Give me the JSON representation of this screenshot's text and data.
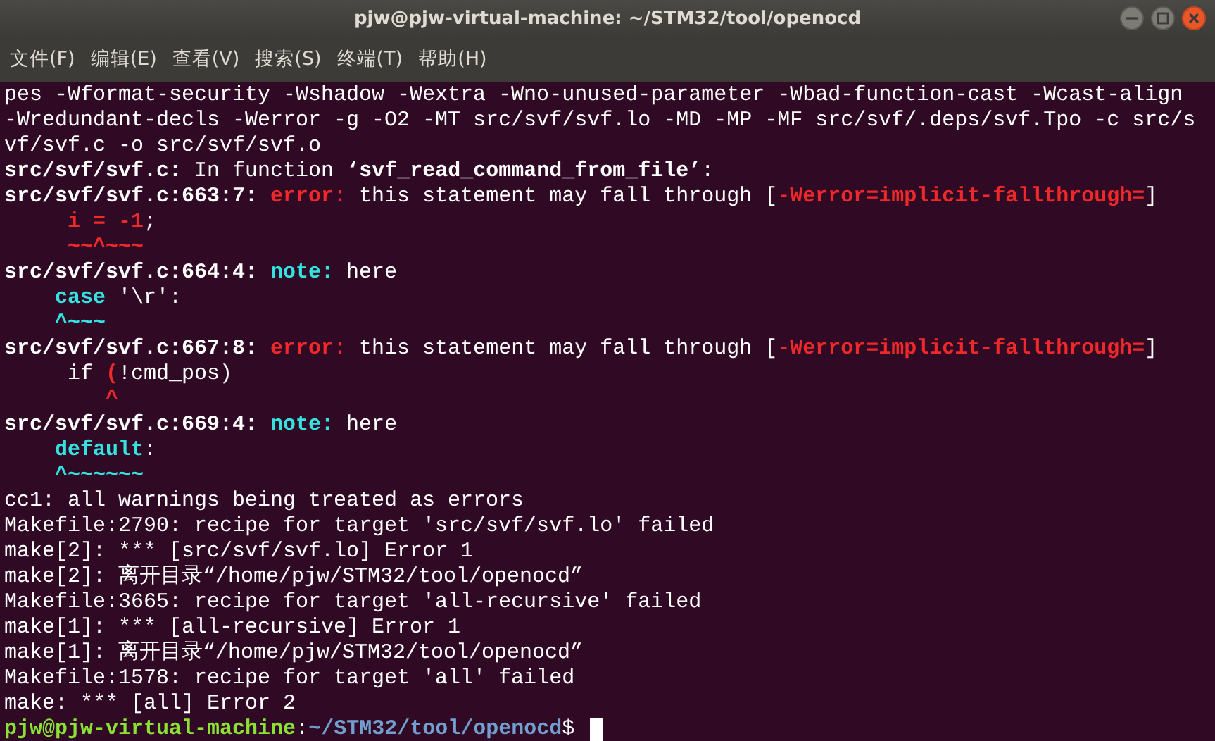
{
  "window": {
    "title": "pjw@pjw-virtual-machine: ~/STM32/tool/openocd"
  },
  "menu": [
    "文件(F)",
    "编辑(E)",
    "查看(V)",
    "搜索(S)",
    "终端(T)",
    "帮助(H)"
  ],
  "terminal": {
    "lines": [
      {
        "segments": [
          {
            "text": "pes -Wformat-security -Wshadow -Wextra -Wno-unused-parameter -Wbad-function-cast -Wcast-align",
            "kind": "plain"
          }
        ]
      },
      {
        "segments": [
          {
            "text": "-Wredundant-decls -Werror -g -O2 -MT src/svf/svf.lo -MD -MP -MF src/svf/.deps/svf.Tpo -c src/s",
            "kind": "plain"
          }
        ]
      },
      {
        "segments": [
          {
            "text": "vf/svf.c -o src/svf/svf.o",
            "kind": "plain"
          }
        ]
      },
      {
        "segments": [
          {
            "text": "src/svf/svf.c:",
            "kind": "bold"
          },
          {
            "text": " In function ",
            "kind": "plain"
          },
          {
            "text": "‘svf_read_command_from_file’",
            "kind": "bold"
          },
          {
            "text": ":",
            "kind": "plain"
          }
        ]
      },
      {
        "segments": [
          {
            "text": "src/svf/svf.c:663:7:",
            "kind": "bold"
          },
          {
            "text": " error:",
            "kind": "error"
          },
          {
            "text": " this statement may fall through [",
            "kind": "plain"
          },
          {
            "text": "-Werror=implicit-fallthrough=",
            "kind": "error"
          },
          {
            "text": "]",
            "kind": "plain"
          }
        ]
      },
      {
        "segments": [
          {
            "text": "     i = -1",
            "kind": "error"
          },
          {
            "text": ";",
            "kind": "plain"
          }
        ]
      },
      {
        "segments": [
          {
            "text": "     ~~^~~~",
            "kind": "error"
          }
        ]
      },
      {
        "segments": [
          {
            "text": "src/svf/svf.c:664:4:",
            "kind": "bold"
          },
          {
            "text": " note:",
            "kind": "note"
          },
          {
            "text": " here",
            "kind": "plain"
          }
        ]
      },
      {
        "segments": [
          {
            "text": "    case",
            "kind": "note"
          },
          {
            "text": " '\\r':",
            "kind": "plain"
          }
        ]
      },
      {
        "segments": [
          {
            "text": "    ^~~~",
            "kind": "note"
          }
        ]
      },
      {
        "segments": [
          {
            "text": "src/svf/svf.c:667:8:",
            "kind": "bold"
          },
          {
            "text": " error:",
            "kind": "error"
          },
          {
            "text": " this statement may fall through [",
            "kind": "plain"
          },
          {
            "text": "-Werror=implicit-fallthrough=",
            "kind": "error"
          },
          {
            "text": "]",
            "kind": "plain"
          }
        ]
      },
      {
        "segments": [
          {
            "text": "     if ",
            "kind": "plain"
          },
          {
            "text": "(",
            "kind": "error"
          },
          {
            "text": "!cmd_pos)",
            "kind": "plain"
          }
        ]
      },
      {
        "segments": [
          {
            "text": "        ^",
            "kind": "error"
          }
        ]
      },
      {
        "segments": [
          {
            "text": "src/svf/svf.c:669:4:",
            "kind": "bold"
          },
          {
            "text": " note:",
            "kind": "note"
          },
          {
            "text": " here",
            "kind": "plain"
          }
        ]
      },
      {
        "segments": [
          {
            "text": "    default",
            "kind": "note"
          },
          {
            "text": ":",
            "kind": "plain"
          }
        ]
      },
      {
        "segments": [
          {
            "text": "    ^~~~~~~",
            "kind": "note"
          }
        ]
      },
      {
        "segments": [
          {
            "text": "cc1: all warnings being treated as errors",
            "kind": "plain"
          }
        ]
      },
      {
        "segments": [
          {
            "text": "Makefile:2790: recipe for target 'src/svf/svf.lo' failed",
            "kind": "plain"
          }
        ]
      },
      {
        "segments": [
          {
            "text": "make[2]: *** [src/svf/svf.lo] Error 1",
            "kind": "plain"
          }
        ]
      },
      {
        "segments": [
          {
            "text": "make[2]: 离开目录“/home/pjw/STM32/tool/openocd”",
            "kind": "plain"
          }
        ]
      },
      {
        "segments": [
          {
            "text": "Makefile:3665: recipe for target 'all-recursive' failed",
            "kind": "plain"
          }
        ]
      },
      {
        "segments": [
          {
            "text": "make[1]: *** [all-recursive] Error 1",
            "kind": "plain"
          }
        ]
      },
      {
        "segments": [
          {
            "text": "make[1]: 离开目录“/home/pjw/STM32/tool/openocd”",
            "kind": "plain"
          }
        ]
      },
      {
        "segments": [
          {
            "text": "Makefile:1578: recipe for target 'all' failed",
            "kind": "plain"
          }
        ]
      },
      {
        "segments": [
          {
            "text": "make: *** [all] Error 2",
            "kind": "plain"
          }
        ]
      },
      {
        "segments": [
          {
            "text": "pjw@pjw-virtual-machine",
            "kind": "user"
          },
          {
            "text": ":",
            "kind": "plain"
          },
          {
            "text": "~/STM32/tool/openocd",
            "kind": "path"
          },
          {
            "text": "$ ",
            "kind": "plain"
          }
        ],
        "cursor": true
      }
    ]
  }
}
